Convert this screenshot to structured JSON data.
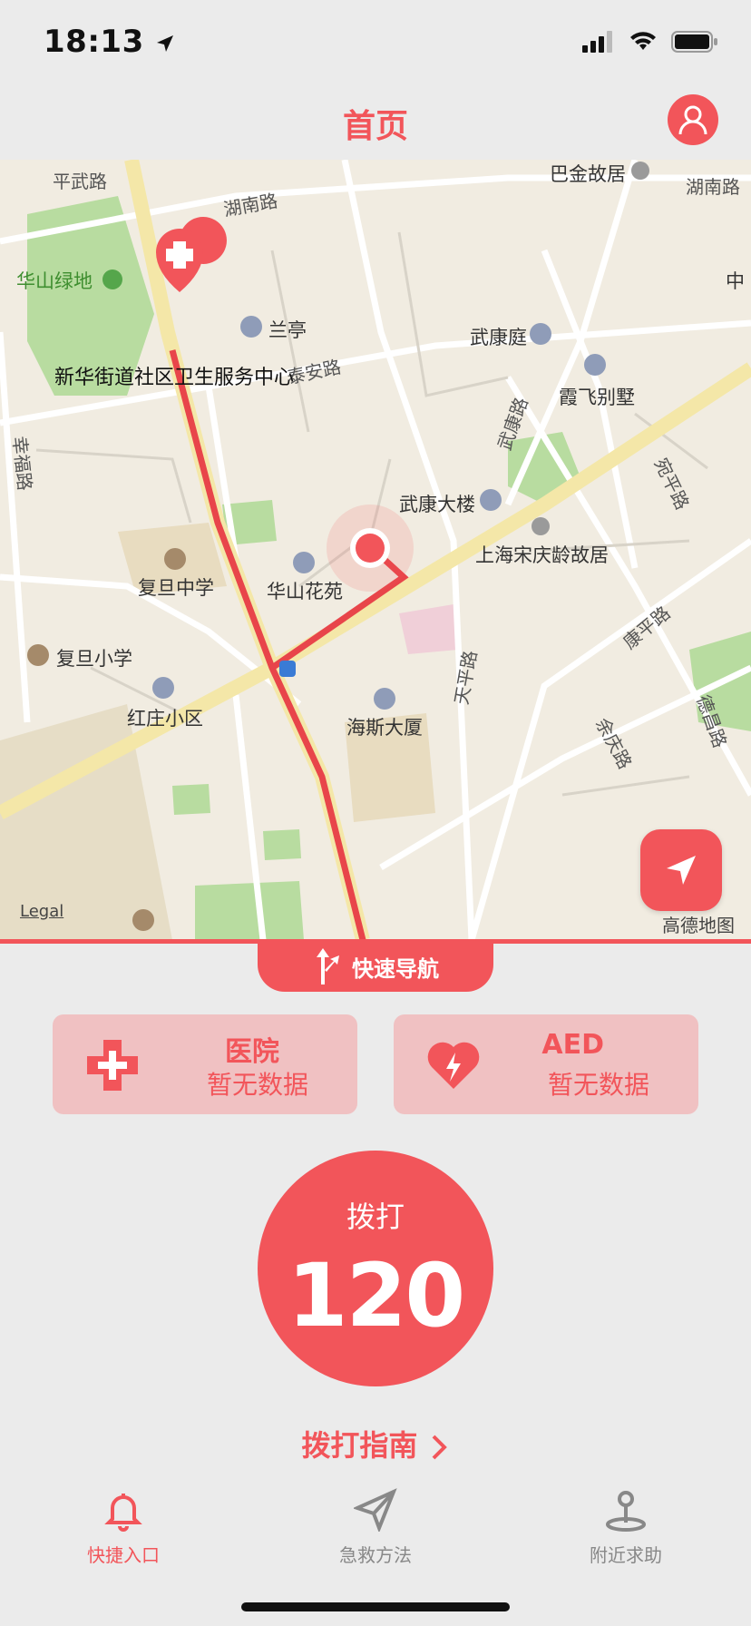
{
  "status_bar": {
    "time": "18:13"
  },
  "nav": {
    "title": "首页"
  },
  "map": {
    "roads": [
      "平武路",
      "湖南路",
      "湖南路",
      "泰安路",
      "幸福路",
      "武康路",
      "天平路",
      "宛平路",
      "康平路",
      "余庆路",
      "德昌路"
    ],
    "pois": [
      "华山绿地",
      "兰亭",
      "武康庭",
      "霞飞别墅",
      "武康大楼",
      "上海宋庆龄故居",
      "复旦中学",
      "华山花苑",
      "复旦小学",
      "红庄小区",
      "海斯大厦",
      "巴金故居",
      "中"
    ],
    "hospital_name": "新华街道社区卫生服务中心",
    "legal": "Legal",
    "provider": "高德地图"
  },
  "quick_nav": {
    "label": "快速导航"
  },
  "cards": {
    "hospital": {
      "title": "医院",
      "subtitle": "暂无数据"
    },
    "aed": {
      "title": "AED",
      "subtitle": "暂无数据"
    }
  },
  "call": {
    "label": "拨打",
    "number": "120"
  },
  "guide": {
    "label": "拨打指南"
  },
  "tabs": [
    {
      "label": "快捷入口",
      "icon": "bell-icon",
      "active": true
    },
    {
      "label": "急救方法",
      "icon": "send-icon",
      "active": false
    },
    {
      "label": "附近求助",
      "icon": "pin-icon",
      "active": false
    }
  ],
  "colors": {
    "accent": "#f2555a",
    "card_bg": "#f0c1c2",
    "background": "#ebebeb"
  }
}
